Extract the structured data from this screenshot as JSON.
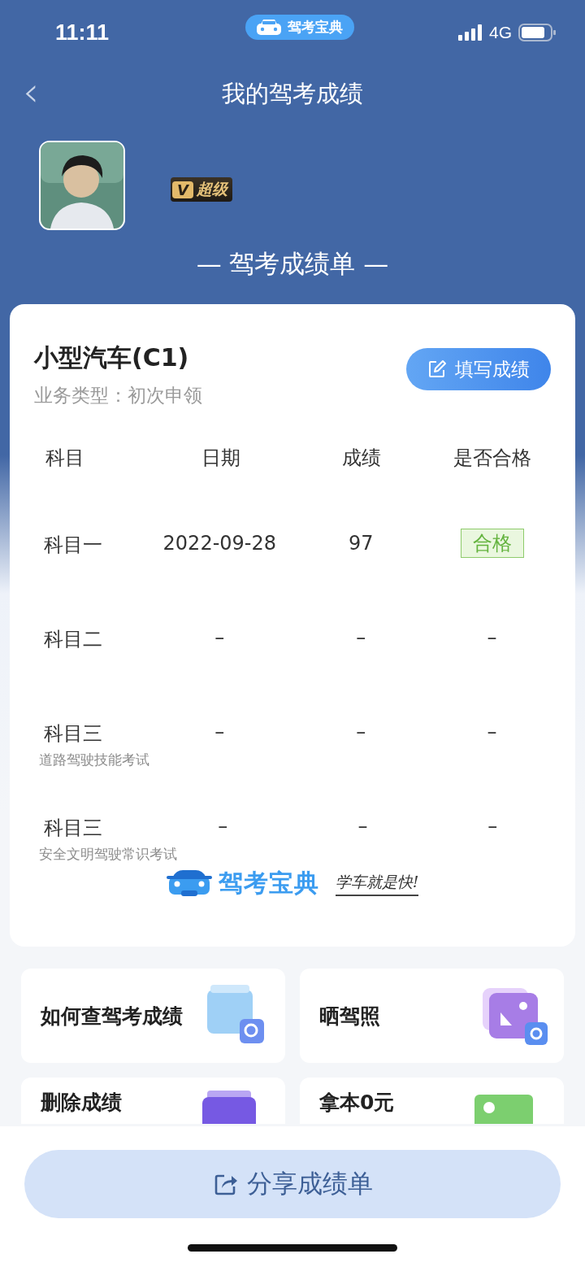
{
  "status_bar": {
    "time": "11:11",
    "app_badge": "驾考宝典",
    "network": "4G"
  },
  "nav": {
    "back": "‹",
    "title": "我的驾考成绩"
  },
  "profile": {
    "vip_label": "超级",
    "vip_letter": "V"
  },
  "sheet_title": "— 驾考成绩单 —",
  "card": {
    "license": "小型汽车(C1)",
    "business_type": "业务类型：初次申领",
    "fill_button": "填写成绩",
    "columns": [
      "科目",
      "日期",
      "成绩",
      "是否合格"
    ],
    "rows": [
      {
        "subject": "科目一",
        "date": "2022-09-28",
        "score": "97",
        "result": "合格",
        "passed": true
      },
      {
        "subject": "科目二",
        "date": "–",
        "score": "–",
        "result": "–",
        "passed": false
      },
      {
        "subject": "科目三",
        "note": "道路驾驶技能考试",
        "date": "–",
        "score": "–",
        "result": "–",
        "passed": false
      },
      {
        "subject": "科目三",
        "note": "安全文明驾驶常识考试",
        "date": "–",
        "score": "–",
        "result": "–",
        "passed": false
      }
    ],
    "brand": "驾考宝典",
    "slogan": "学车就是快!"
  },
  "tiles": [
    {
      "label": "如何查驾考成绩",
      "kind": "search"
    },
    {
      "label": "晒驾照",
      "kind": "photo"
    },
    {
      "label": "删除成绩",
      "kind": "delete"
    },
    {
      "label": "拿本0元",
      "kind": "money"
    }
  ],
  "share_button": "分享成绩单"
}
